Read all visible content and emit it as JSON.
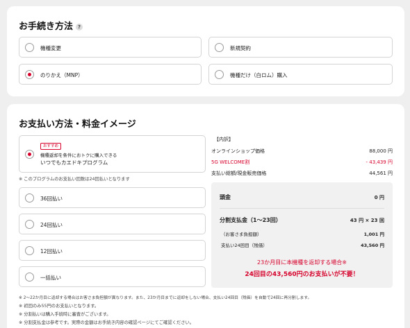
{
  "procedure": {
    "title": "お手続き方法",
    "help_icon": "?",
    "options": [
      {
        "label": "機種変更",
        "selected": false
      },
      {
        "label": "新規契約",
        "selected": false
      },
      {
        "label": "のりかえ（MNP）",
        "selected": true
      },
      {
        "label": "機種だけ（白ロム）購入",
        "selected": false
      }
    ]
  },
  "payment": {
    "title": "お支払い方法・料金イメージ",
    "program": {
      "badge": "おすすめ",
      "line1": "機種返却を条件におトクに購入できる",
      "line2": "いつでもカエドキプログラム",
      "selected": true
    },
    "program_note": "※ このプログラムのお支払い回数は24回払いとなります",
    "installments": [
      "36回払い",
      "24回払い",
      "12回払い",
      "一括払い"
    ]
  },
  "breakdown": {
    "title": "【内訳】",
    "rows": [
      {
        "label": "オンラインショップ価格",
        "value": "88,000 円",
        "highlight": false
      },
      {
        "label": "5G WELCOME割",
        "value": "- 43,439 円",
        "highlight": true
      },
      {
        "label": "支払い総額/現金販売価格",
        "value": "44,561 円",
        "highlight": false
      }
    ],
    "down_payment_label": "頭金",
    "down_payment_value": "0 円",
    "installment_label": "分割支払金（1〜23回）",
    "installment_value": "43 円 × 23 回",
    "customer_burden_label": "（お客さま負担額）",
    "customer_burden_value": "1,001 円",
    "final_label": "支払い24回目（残価）",
    "final_value": "43,560 円",
    "promo_line1": "23か月目に本機種を返却する場合※",
    "promo_line2": "24回目の43,560円のお支払いが不要！"
  },
  "footnotes": [
    "※ 2〜22か月目に返却する場合はお客さま負担額が異なります。また、23か月目までに返却をしない場合、支払い24回目（残価）を自動で24回に再分割します。",
    "※ 初回のみ55円のお支払いとなります。",
    "※ 分割払いは購入手続時に審査がございます。",
    "※ 分割支払金は参考です。実際の金額はお手続き内容の確認ページにてご確認ください。"
  ],
  "colors": {
    "accent": "#d6002a",
    "panel": "#f1f1f1",
    "background": "#efefef"
  }
}
